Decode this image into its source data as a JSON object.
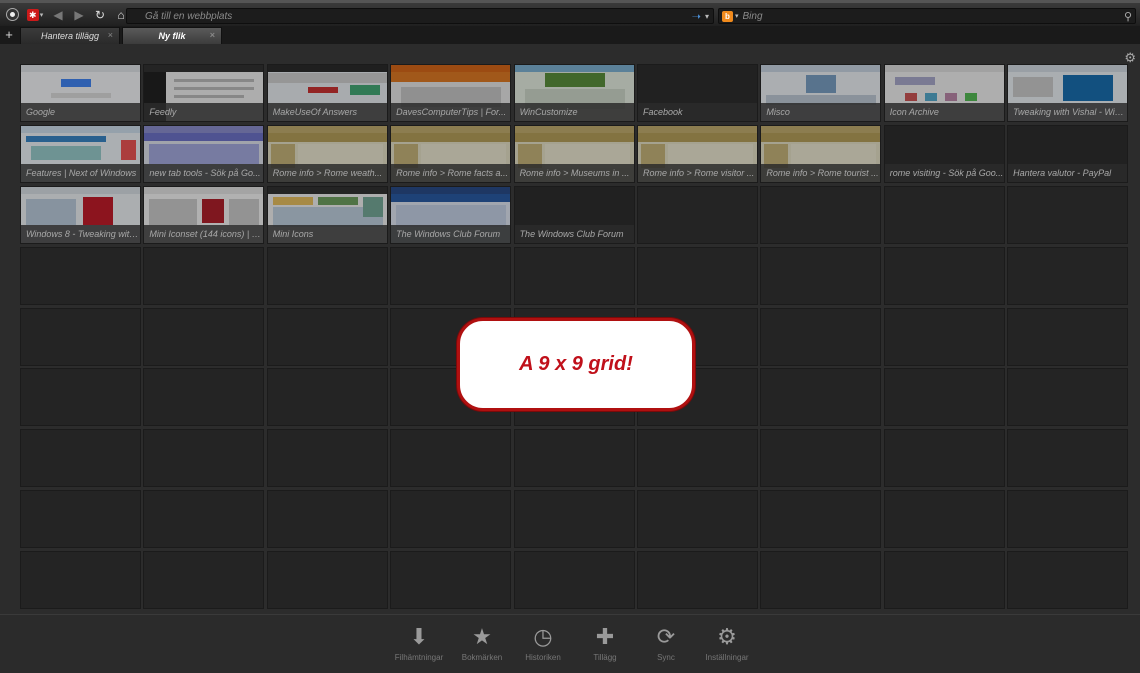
{
  "toolbar": {
    "url_placeholder": "Gå till en webbplats",
    "search_placeholder": "Bing",
    "engine_icon": "bing-icon",
    "colors": {
      "accent_red": "#cc1a1a",
      "go_arrow": "#4a90d9",
      "engine_orange": "#f08a1c"
    }
  },
  "tabs": [
    {
      "label": "Hantera tillägg",
      "active": false
    },
    {
      "label": "Ny flik",
      "active": true
    }
  ],
  "speed_dial": {
    "grid": "9x9",
    "tiles": [
      {
        "label": "Google",
        "theme": "google"
      },
      {
        "label": "Feedly",
        "theme": "feedly"
      },
      {
        "label": "MakeUseOf Answers",
        "theme": "muo"
      },
      {
        "label": "DavesComputerTips | For...",
        "theme": "daves"
      },
      {
        "label": "WinCustomize",
        "theme": "wincust"
      },
      {
        "label": "Facebook",
        "theme": "dark"
      },
      {
        "label": "Misco",
        "theme": "misco"
      },
      {
        "label": "Icon Archive",
        "theme": "iconarch"
      },
      {
        "label": "Tweaking with Vishal - Win...",
        "theme": "tweak"
      },
      {
        "label": "Features | Next of Windows",
        "theme": "features"
      },
      {
        "label": "new tab tools - Sök på Go...",
        "theme": "newtab"
      },
      {
        "label": "Rome info > Rome weath...",
        "theme": "rome"
      },
      {
        "label": "Rome info > Rome facts a...",
        "theme": "rome"
      },
      {
        "label": "Rome info > Museums in ...",
        "theme": "rome"
      },
      {
        "label": "Rome info > Rome visitor ...",
        "theme": "rome"
      },
      {
        "label": "Rome info > Rome tourist ...",
        "theme": "rome"
      },
      {
        "label": "rome visiting - Sök på Goo...",
        "theme": "dark"
      },
      {
        "label": "Hantera valutor - PayPal",
        "theme": "dark"
      },
      {
        "label": "Windows 8 - Tweaking with...",
        "theme": "win8"
      },
      {
        "label": "Mini Iconset (144 icons) | F...",
        "theme": "miniset"
      },
      {
        "label": "Mini Icons",
        "theme": "miniicons"
      },
      {
        "label": "The Windows Club Forum",
        "theme": "twc"
      },
      {
        "label": "The Windows Club Forum",
        "theme": "dark"
      }
    ]
  },
  "annotation": {
    "text": "A 9 x 9 grid!",
    "color": "#c0101a"
  },
  "bottombar": [
    {
      "label": "Filhämtningar",
      "icon": "download-icon"
    },
    {
      "label": "Bokmärken",
      "icon": "star-icon"
    },
    {
      "label": "Historiken",
      "icon": "clock-icon"
    },
    {
      "label": "Tillägg",
      "icon": "puzzle-icon"
    },
    {
      "label": "Sync",
      "icon": "sync-icon"
    },
    {
      "label": "Inställningar",
      "icon": "gear-icon"
    }
  ]
}
